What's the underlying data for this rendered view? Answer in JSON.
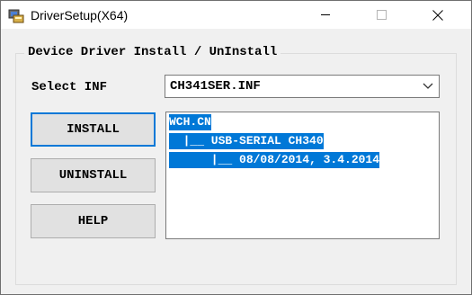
{
  "window": {
    "title": "DriverSetup(X64)",
    "icons": {
      "app": "driver-setup-icon",
      "minimize": "minimize-icon",
      "maximize": "maximize-icon",
      "close": "close-icon"
    }
  },
  "group": {
    "title": "Device Driver Install / UnInstall"
  },
  "select_inf": {
    "label": "Select INF",
    "value": "CH341SER.INF",
    "dropdown_icon": "chevron-down-icon"
  },
  "buttons": {
    "install": "INSTALL",
    "uninstall": "UNINSTALL",
    "help": "HELP"
  },
  "driver_tree": {
    "lines": [
      "WCH.CN",
      "  |__ USB-SERIAL CH340",
      "      |__ 08/08/2014, 3.4.2014"
    ],
    "selection_color": "#0078d7"
  }
}
